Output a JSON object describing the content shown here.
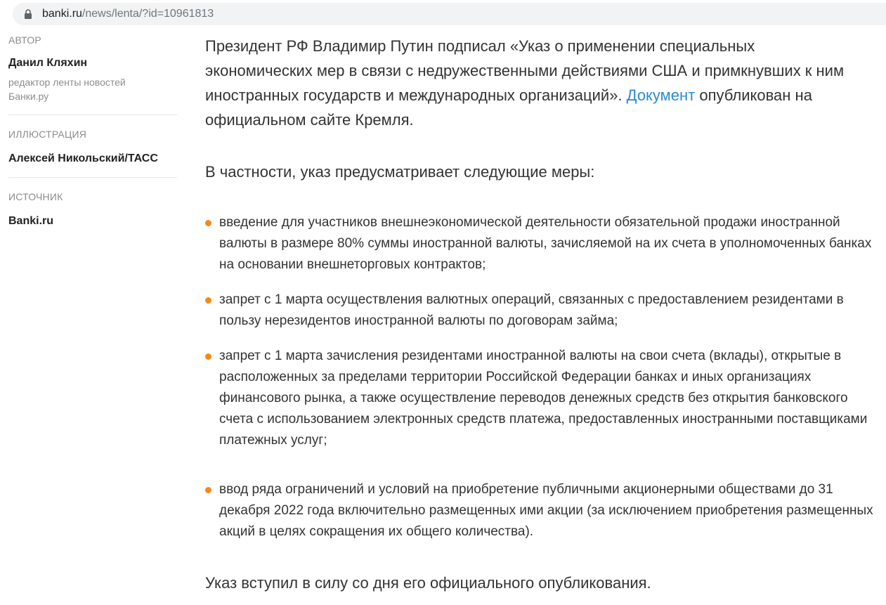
{
  "browser": {
    "url_host": "banki.ru",
    "url_path": "/news/lenta/?id=10961813"
  },
  "sidebar": {
    "author": {
      "label": "АВТОР",
      "name": "Данил Кляхин",
      "role": "редактор ленты новостей Банки.ру"
    },
    "illustration": {
      "label": "ИЛЛЮСТРАЦИЯ",
      "name": "Алексей Никольский/ТАСС"
    },
    "source": {
      "label": "ИСТОЧНИК",
      "name": "Banki.ru"
    }
  },
  "article": {
    "lead_before_link": "Президент РФ Владимир Путин подписал «Указ о применении специальных экономических мер в связи с недружественными действиями США и примкнувших к ним иностранных государств и международных организаций». ",
    "lead_link": "Документ",
    "lead_after_link": " опубликован на официальном сайте Кремля.",
    "intro": "В частности, указ предусматривает следующие меры:",
    "bullets": [
      "введение для участников внешнеэкономической деятельности обязательной продажи иностранной валюты в размере 80% суммы иностранной валюты, зачисляемой на их счета в уполномоченных банках на основании внешнеторговых контрактов;",
      "запрет с 1 марта осуществления валютных операций, связанных с предоставлением резидентами в пользу нерезидентов иностранной валюты по договорам займа;",
      "запрет с 1 марта зачисления резидентами иностранной валюты на свои счета (вклады), открытые в расположенных за пределами территории Российской Федерации банках и иных организациях финансового рынка, а также осуществление переводов денежных средств без открытия банковского счета с использованием электронных средств платежа, предоставленных иностранными поставщиками платежных услуг;",
      "ввод ряда ограничений и условий на приобретение публичными акционерными обществами до 31 декабря 2022 года включительно размещенных ими акции (за исключением приобретения размещенных акций в целях сокращения их общего количества)."
    ],
    "closing": "Указ вступил в силу со дня его официального опубликования."
  },
  "colors": {
    "link": "#2a8bd1",
    "bullet": "#f28a1b",
    "text": "#333333",
    "muted": "#8c8c8c"
  },
  "icons": {
    "address_bar": "lock-icon",
    "bullet": "bullet-dot-icon"
  }
}
